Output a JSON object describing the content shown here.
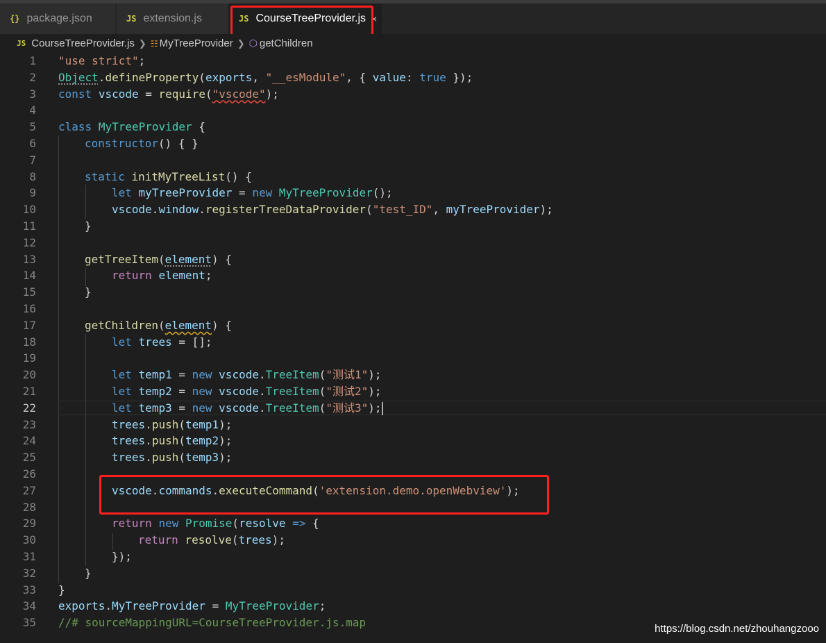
{
  "tabs": [
    {
      "label": "package.json",
      "icon": "{}"
    },
    {
      "label": "extension.js",
      "icon": "JS"
    },
    {
      "label": "CourseTreeProvider.js",
      "icon": "JS",
      "close": "×"
    }
  ],
  "breadcrumb": {
    "file": "CourseTreeProvider.js",
    "class_name": "MyTreeProvider",
    "method": "getChildren",
    "js_icon": "JS"
  },
  "editor": {
    "current_line": 22,
    "line_numbers": [
      "1",
      "2",
      "3",
      "4",
      "5",
      "6",
      "7",
      "8",
      "9",
      "10",
      "11",
      "12",
      "13",
      "14",
      "15",
      "16",
      "17",
      "18",
      "19",
      "20",
      "21",
      "22",
      "23",
      "24",
      "25",
      "26",
      "27",
      "28",
      "29",
      "30",
      "31",
      "32",
      "33",
      "34",
      "35"
    ],
    "code": {
      "l1": [
        "\"use strict\"",
        ";"
      ],
      "l2": [
        "Object",
        ".",
        "defineProperty",
        "(",
        "exports",
        ", ",
        "\"__esModule\"",
        ", { ",
        "value",
        ": ",
        "true",
        " });"
      ],
      "l3": [
        "const",
        " ",
        "vscode",
        " = ",
        "require",
        "(",
        "\"vscode\"",
        ");"
      ],
      "l5": [
        "class",
        " ",
        "MyTreeProvider",
        " {"
      ],
      "l6": [
        "constructor",
        "() { }"
      ],
      "l8": [
        "static",
        " ",
        "initMyTreeList",
        "() {"
      ],
      "l9": [
        "let",
        " ",
        "myTreeProvider",
        " = ",
        "new",
        " ",
        "MyTreeProvider",
        "();"
      ],
      "l10": [
        "vscode",
        ".",
        "window",
        ".",
        "registerTreeDataProvider",
        "(",
        "\"test_ID\"",
        ", ",
        "myTreeProvider",
        ");"
      ],
      "l11": [
        "}"
      ],
      "l13": [
        "getTreeItem",
        "(",
        "element",
        ") {"
      ],
      "l14": [
        "return",
        " ",
        "element",
        ";"
      ],
      "l15": [
        "}"
      ],
      "l17": [
        "getChildren",
        "(",
        "element",
        ") {"
      ],
      "l18": [
        "let",
        " ",
        "trees",
        " = [];"
      ],
      "l20": [
        "let",
        " ",
        "temp1",
        " = ",
        "new",
        " ",
        "vscode",
        ".",
        "TreeItem",
        "(",
        "\"测试1\"",
        ");"
      ],
      "l21": [
        "let",
        " ",
        "temp2",
        " = ",
        "new",
        " ",
        "vscode",
        ".",
        "TreeItem",
        "(",
        "\"测试2\"",
        ");"
      ],
      "l22": [
        "let",
        " ",
        "temp3",
        " = ",
        "new",
        " ",
        "vscode",
        ".",
        "TreeItem",
        "(",
        "\"测试3\"",
        ");"
      ],
      "l23": [
        "trees",
        ".",
        "push",
        "(",
        "temp1",
        ");"
      ],
      "l24": [
        "trees",
        ".",
        "push",
        "(",
        "temp2",
        ");"
      ],
      "l25": [
        "trees",
        ".",
        "push",
        "(",
        "temp3",
        ");"
      ],
      "l27": [
        "vscode",
        ".",
        "commands",
        ".",
        "executeCommand",
        "(",
        "'extension.demo.openWebview'",
        ");"
      ],
      "l29": [
        "return",
        " ",
        "new",
        " ",
        "Promise",
        "(",
        "resolve",
        " ",
        "=>",
        " {"
      ],
      "l30": [
        "return",
        " ",
        "resolve",
        "(",
        "trees",
        ");"
      ],
      "l31": [
        "});"
      ],
      "l32": [
        "}"
      ],
      "l33": [
        "}"
      ],
      "l34": [
        "exports",
        ".",
        "MyTreeProvider",
        " = ",
        "MyTreeProvider",
        ";"
      ],
      "l35": [
        "//# sourceMappingURL=CourseTreeProvider.js.map"
      ]
    }
  },
  "watermark": "https://blog.csdn.net/zhouhangzooo",
  "colors": {
    "editor_bg": "#1e1e1e",
    "keyword": "#569cd6",
    "control": "#c586c0",
    "string": "#ce9178",
    "function": "#dcdcaa",
    "type": "#4ec9b0",
    "variable": "#9cdcfe",
    "comment": "#6a9955",
    "highlight": "#ff2020"
  }
}
